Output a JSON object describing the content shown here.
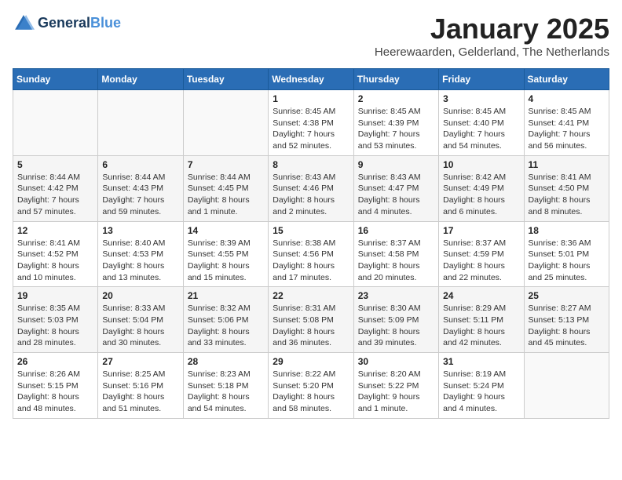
{
  "header": {
    "logo_line1": "General",
    "logo_line2": "Blue",
    "month": "January 2025",
    "location": "Heerewaarden, Gelderland, The Netherlands"
  },
  "days_of_week": [
    "Sunday",
    "Monday",
    "Tuesday",
    "Wednesday",
    "Thursday",
    "Friday",
    "Saturday"
  ],
  "weeks": [
    [
      {
        "day": "",
        "info": ""
      },
      {
        "day": "",
        "info": ""
      },
      {
        "day": "",
        "info": ""
      },
      {
        "day": "1",
        "info": "Sunrise: 8:45 AM\nSunset: 4:38 PM\nDaylight: 7 hours and 52 minutes."
      },
      {
        "day": "2",
        "info": "Sunrise: 8:45 AM\nSunset: 4:39 PM\nDaylight: 7 hours and 53 minutes."
      },
      {
        "day": "3",
        "info": "Sunrise: 8:45 AM\nSunset: 4:40 PM\nDaylight: 7 hours and 54 minutes."
      },
      {
        "day": "4",
        "info": "Sunrise: 8:45 AM\nSunset: 4:41 PM\nDaylight: 7 hours and 56 minutes."
      }
    ],
    [
      {
        "day": "5",
        "info": "Sunrise: 8:44 AM\nSunset: 4:42 PM\nDaylight: 7 hours and 57 minutes."
      },
      {
        "day": "6",
        "info": "Sunrise: 8:44 AM\nSunset: 4:43 PM\nDaylight: 7 hours and 59 minutes."
      },
      {
        "day": "7",
        "info": "Sunrise: 8:44 AM\nSunset: 4:45 PM\nDaylight: 8 hours and 1 minute."
      },
      {
        "day": "8",
        "info": "Sunrise: 8:43 AM\nSunset: 4:46 PM\nDaylight: 8 hours and 2 minutes."
      },
      {
        "day": "9",
        "info": "Sunrise: 8:43 AM\nSunset: 4:47 PM\nDaylight: 8 hours and 4 minutes."
      },
      {
        "day": "10",
        "info": "Sunrise: 8:42 AM\nSunset: 4:49 PM\nDaylight: 8 hours and 6 minutes."
      },
      {
        "day": "11",
        "info": "Sunrise: 8:41 AM\nSunset: 4:50 PM\nDaylight: 8 hours and 8 minutes."
      }
    ],
    [
      {
        "day": "12",
        "info": "Sunrise: 8:41 AM\nSunset: 4:52 PM\nDaylight: 8 hours and 10 minutes."
      },
      {
        "day": "13",
        "info": "Sunrise: 8:40 AM\nSunset: 4:53 PM\nDaylight: 8 hours and 13 minutes."
      },
      {
        "day": "14",
        "info": "Sunrise: 8:39 AM\nSunset: 4:55 PM\nDaylight: 8 hours and 15 minutes."
      },
      {
        "day": "15",
        "info": "Sunrise: 8:38 AM\nSunset: 4:56 PM\nDaylight: 8 hours and 17 minutes."
      },
      {
        "day": "16",
        "info": "Sunrise: 8:37 AM\nSunset: 4:58 PM\nDaylight: 8 hours and 20 minutes."
      },
      {
        "day": "17",
        "info": "Sunrise: 8:37 AM\nSunset: 4:59 PM\nDaylight: 8 hours and 22 minutes."
      },
      {
        "day": "18",
        "info": "Sunrise: 8:36 AM\nSunset: 5:01 PM\nDaylight: 8 hours and 25 minutes."
      }
    ],
    [
      {
        "day": "19",
        "info": "Sunrise: 8:35 AM\nSunset: 5:03 PM\nDaylight: 8 hours and 28 minutes."
      },
      {
        "day": "20",
        "info": "Sunrise: 8:33 AM\nSunset: 5:04 PM\nDaylight: 8 hours and 30 minutes."
      },
      {
        "day": "21",
        "info": "Sunrise: 8:32 AM\nSunset: 5:06 PM\nDaylight: 8 hours and 33 minutes."
      },
      {
        "day": "22",
        "info": "Sunrise: 8:31 AM\nSunset: 5:08 PM\nDaylight: 8 hours and 36 minutes."
      },
      {
        "day": "23",
        "info": "Sunrise: 8:30 AM\nSunset: 5:09 PM\nDaylight: 8 hours and 39 minutes."
      },
      {
        "day": "24",
        "info": "Sunrise: 8:29 AM\nSunset: 5:11 PM\nDaylight: 8 hours and 42 minutes."
      },
      {
        "day": "25",
        "info": "Sunrise: 8:27 AM\nSunset: 5:13 PM\nDaylight: 8 hours and 45 minutes."
      }
    ],
    [
      {
        "day": "26",
        "info": "Sunrise: 8:26 AM\nSunset: 5:15 PM\nDaylight: 8 hours and 48 minutes."
      },
      {
        "day": "27",
        "info": "Sunrise: 8:25 AM\nSunset: 5:16 PM\nDaylight: 8 hours and 51 minutes."
      },
      {
        "day": "28",
        "info": "Sunrise: 8:23 AM\nSunset: 5:18 PM\nDaylight: 8 hours and 54 minutes."
      },
      {
        "day": "29",
        "info": "Sunrise: 8:22 AM\nSunset: 5:20 PM\nDaylight: 8 hours and 58 minutes."
      },
      {
        "day": "30",
        "info": "Sunrise: 8:20 AM\nSunset: 5:22 PM\nDaylight: 9 hours and 1 minute."
      },
      {
        "day": "31",
        "info": "Sunrise: 8:19 AM\nSunset: 5:24 PM\nDaylight: 9 hours and 4 minutes."
      },
      {
        "day": "",
        "info": ""
      }
    ]
  ]
}
